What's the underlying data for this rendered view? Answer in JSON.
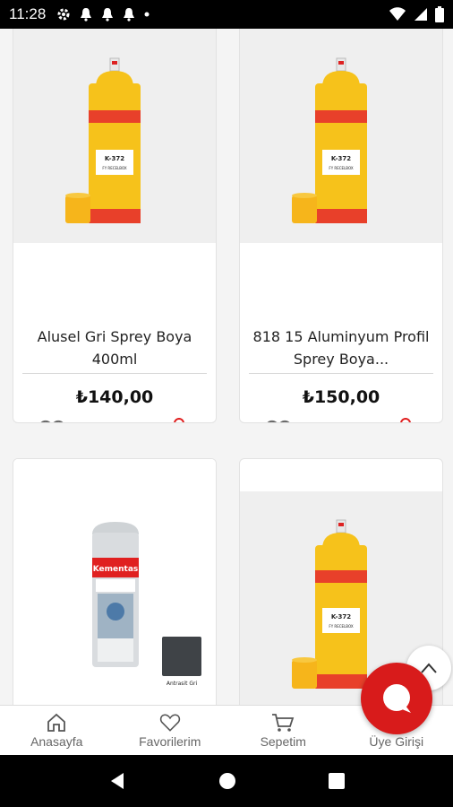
{
  "status_bar": {
    "time": "11:28"
  },
  "products": [
    {
      "title": "Alusel Gri Sprey Boya 400ml",
      "price": "₺140,00",
      "can_code": "K-372",
      "can_sub": "FY RECELBOX"
    },
    {
      "title": "818 15 Aluminyum Profil Sprey Boya...",
      "price": "₺150,00",
      "can_code": "K-372",
      "can_sub": "FY RECELBOX"
    },
    {
      "title": "",
      "price": "",
      "brand": "Kementas",
      "swatch_label": "Antrasit Gri"
    },
    {
      "title": "",
      "price": "",
      "can_code": "K-372",
      "can_sub": "FY RECELBOX"
    }
  ],
  "bottom_nav": [
    {
      "label": "Anasayfa",
      "icon": "home-icon"
    },
    {
      "label": "Favorilerim",
      "icon": "heart-icon"
    },
    {
      "label": "Sepetim",
      "icon": "cart-icon"
    },
    {
      "label": "Üye Girişi",
      "icon": "user-icon"
    }
  ],
  "colors": {
    "accent": "#d81b1b",
    "can_yellow": "#f6c21b",
    "can_red": "#e8402a"
  }
}
